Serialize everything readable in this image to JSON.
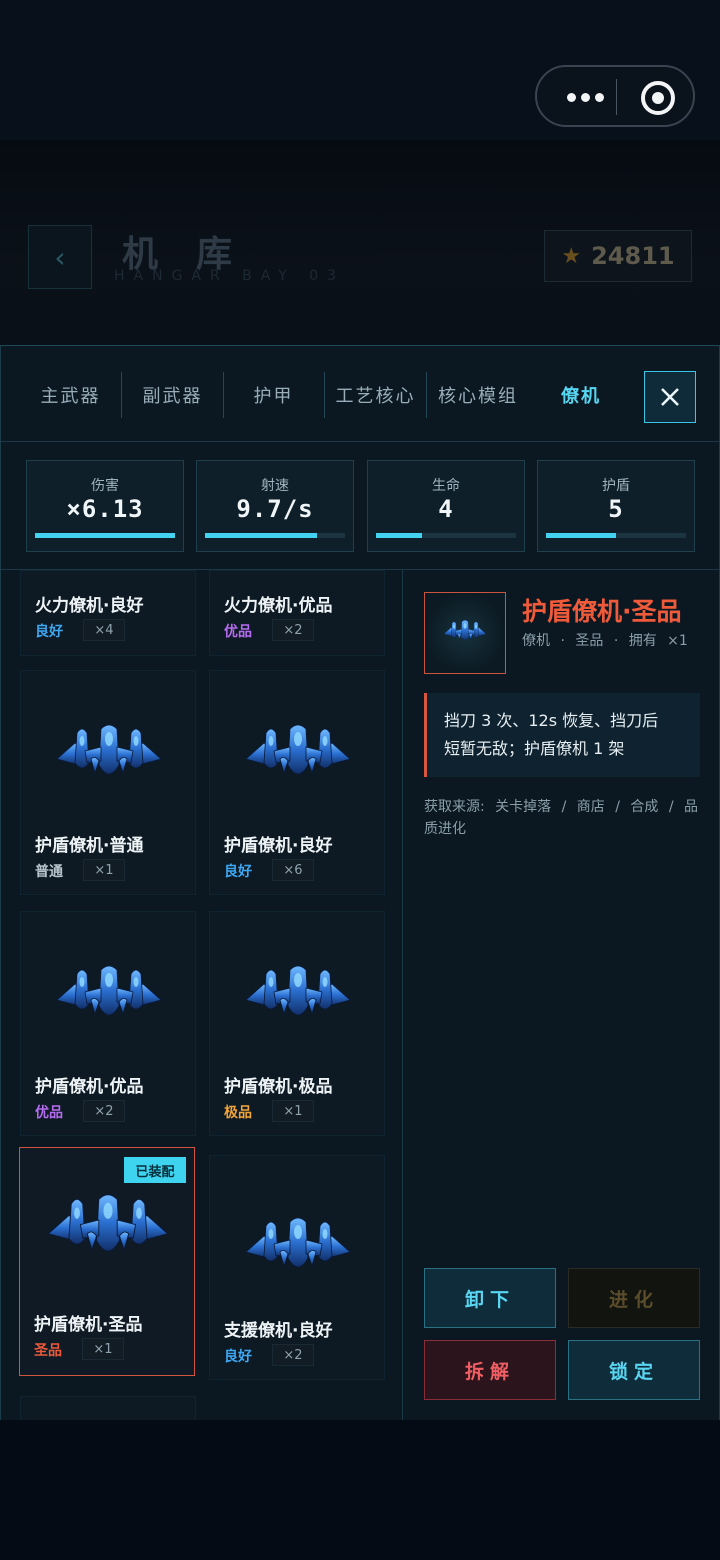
{
  "header": {
    "back_icon": "chevron-left-icon",
    "title": "机库",
    "subtitle": "HANGAR BAY 03",
    "coins": "24811",
    "coin_icon": "star-icon"
  },
  "tabs": [
    {
      "label": "主武器",
      "active": false
    },
    {
      "label": "副武器",
      "active": false
    },
    {
      "label": "护甲",
      "active": false
    },
    {
      "label": "工艺核心",
      "active": false
    },
    {
      "label": "核心模组",
      "active": false
    },
    {
      "label": "僚机",
      "active": true
    }
  ],
  "stats": [
    {
      "label": "伤害",
      "value": "×6.13",
      "fill": 1.0
    },
    {
      "label": "射速",
      "value": "9.7/s",
      "fill": 0.8
    },
    {
      "label": "生命",
      "value": "4",
      "fill": 0.33
    },
    {
      "label": "护盾",
      "value": "5",
      "fill": 0.5
    }
  ],
  "items": [
    {
      "name": "火力僚机·良好",
      "quality": "良好",
      "count": "×4"
    },
    {
      "name": "火力僚机·优品",
      "quality": "优品",
      "count": "×2"
    },
    {
      "name": "护盾僚机·普通",
      "quality": "普通",
      "count": "×1"
    },
    {
      "name": "护盾僚机·良好",
      "quality": "良好",
      "count": "×6"
    },
    {
      "name": "护盾僚机·优品",
      "quality": "优品",
      "count": "×2"
    },
    {
      "name": "护盾僚机·极品",
      "quality": "极品",
      "count": "×1"
    },
    {
      "name": "护盾僚机·圣品",
      "quality": "圣品",
      "count": "×1",
      "badge": "已装配",
      "selected": true
    },
    {
      "name": "支援僚机·良好",
      "quality": "良好",
      "count": "×2"
    }
  ],
  "colors": {
    "accent": "#43d3f0",
    "good": "#3fa7f2",
    "excellent": "#b66cf0",
    "normal": "#b9c5cc",
    "epic": "#f1a437",
    "holy": "#ec5a3a"
  },
  "detail": {
    "name": "护盾僚机·圣品",
    "meta": [
      "僚机",
      "·",
      "圣品",
      "·",
      "拥有",
      "×1"
    ],
    "description_line1": "挡刀 3 次、12s 恢复、挡刀后",
    "description_line2": "短暂无敌；护盾僚机 1 架",
    "source": [
      "获取来源:",
      "关卡掉落",
      "/",
      "商店",
      "/",
      "合成",
      "/",
      "品质进化"
    ]
  },
  "actions": {
    "unload": "卸下",
    "evolve": "进化",
    "dismantle": "拆解",
    "lock": "锁定"
  }
}
